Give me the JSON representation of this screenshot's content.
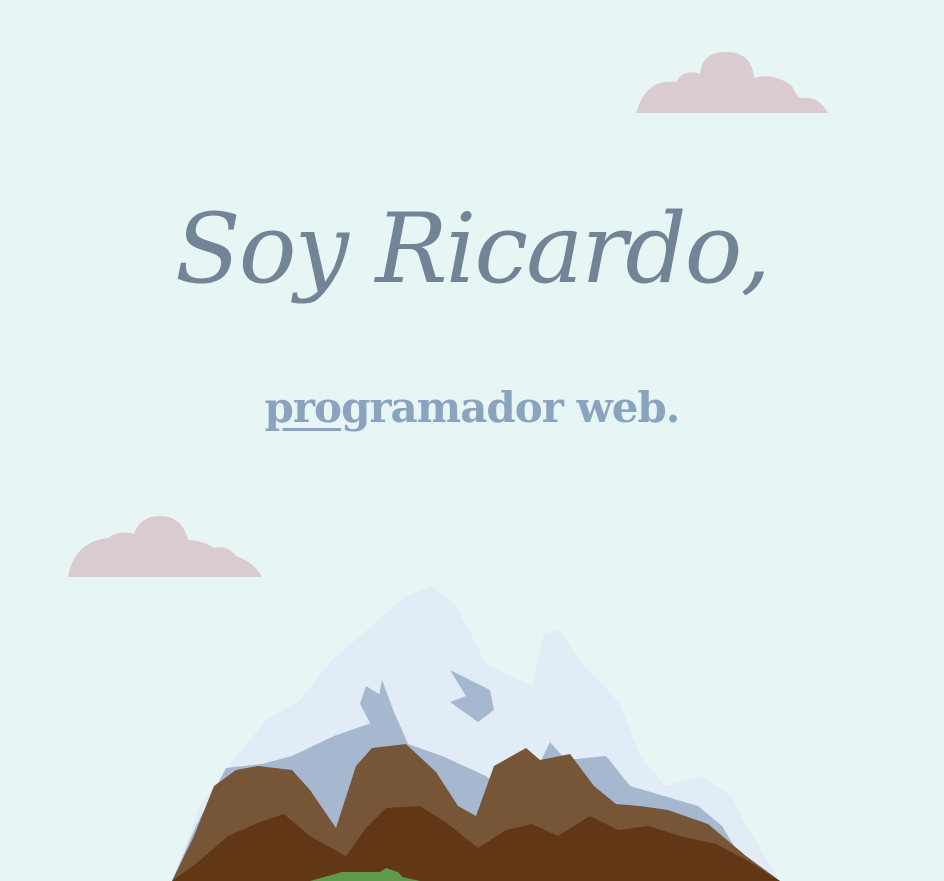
{
  "hero": {
    "greeting": "Soy Ricardo,",
    "role_underlined": "pro",
    "role_rest": "gramador web."
  },
  "colors": {
    "background": "#e8f5f5",
    "greeting_text": "#738496",
    "role_text": "#8aa3bf",
    "cloud": "#d9cbd0",
    "snow": "#e1ecf7",
    "snow_shadow": "#a5b8cf",
    "rock_light": "#775637",
    "rock_dark": "#623716",
    "grass": "#5d9a4a"
  },
  "icons": {
    "cloud_top": "cloud-icon",
    "cloud_left": "cloud-icon",
    "mountain": "mountain-icon"
  }
}
